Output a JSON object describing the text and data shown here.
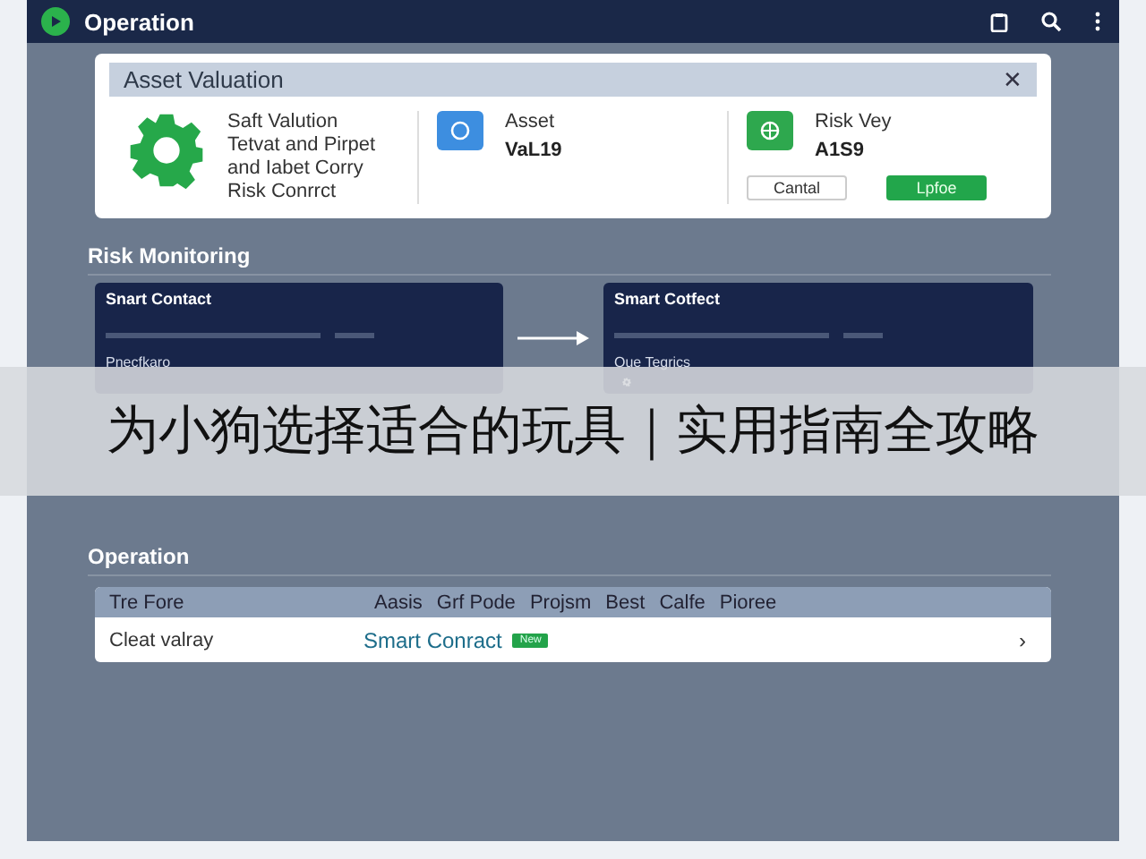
{
  "window": {
    "title": "Operation"
  },
  "dialog": {
    "title": "Asset Valuation",
    "description": "Saft Valution\nTetvat and Pirpet\nand Iabet Corry\nRisk Conrrct",
    "stats": [
      {
        "label": "Asset",
        "value": "VaL19",
        "kind": "clock"
      },
      {
        "label": "Risk Vey",
        "value": "A1S9",
        "kind": "globe"
      }
    ],
    "close": "✕",
    "buttons": [
      {
        "label": "Cantal",
        "kind": "secondary"
      },
      {
        "label": "Lpfoe",
        "kind": "primary"
      }
    ]
  },
  "risk_monitoring": {
    "title": "Risk Monitoring",
    "cards": [
      {
        "title": "Snart Contact",
        "subtitle": "Pnecfkaro",
        "kind": "plain"
      },
      {
        "title": "Smart Cotfect",
        "subtitle": "Oue Tegrics",
        "kind": "gear"
      }
    ]
  },
  "banner": {
    "text": "为小狗选择适合的玩具｜实用指南全攻略"
  },
  "operation": {
    "title": "Operation",
    "table": {
      "columns": [
        "Tre Fore",
        "Aasis",
        "Grf Pode",
        "Projsm",
        "Best",
        "Calfe",
        "Pioree"
      ],
      "rows": [
        {
          "name": "Cleat valray",
          "contract": "Smart Conract",
          "badge": "New",
          "chevron": "›"
        }
      ]
    }
  }
}
